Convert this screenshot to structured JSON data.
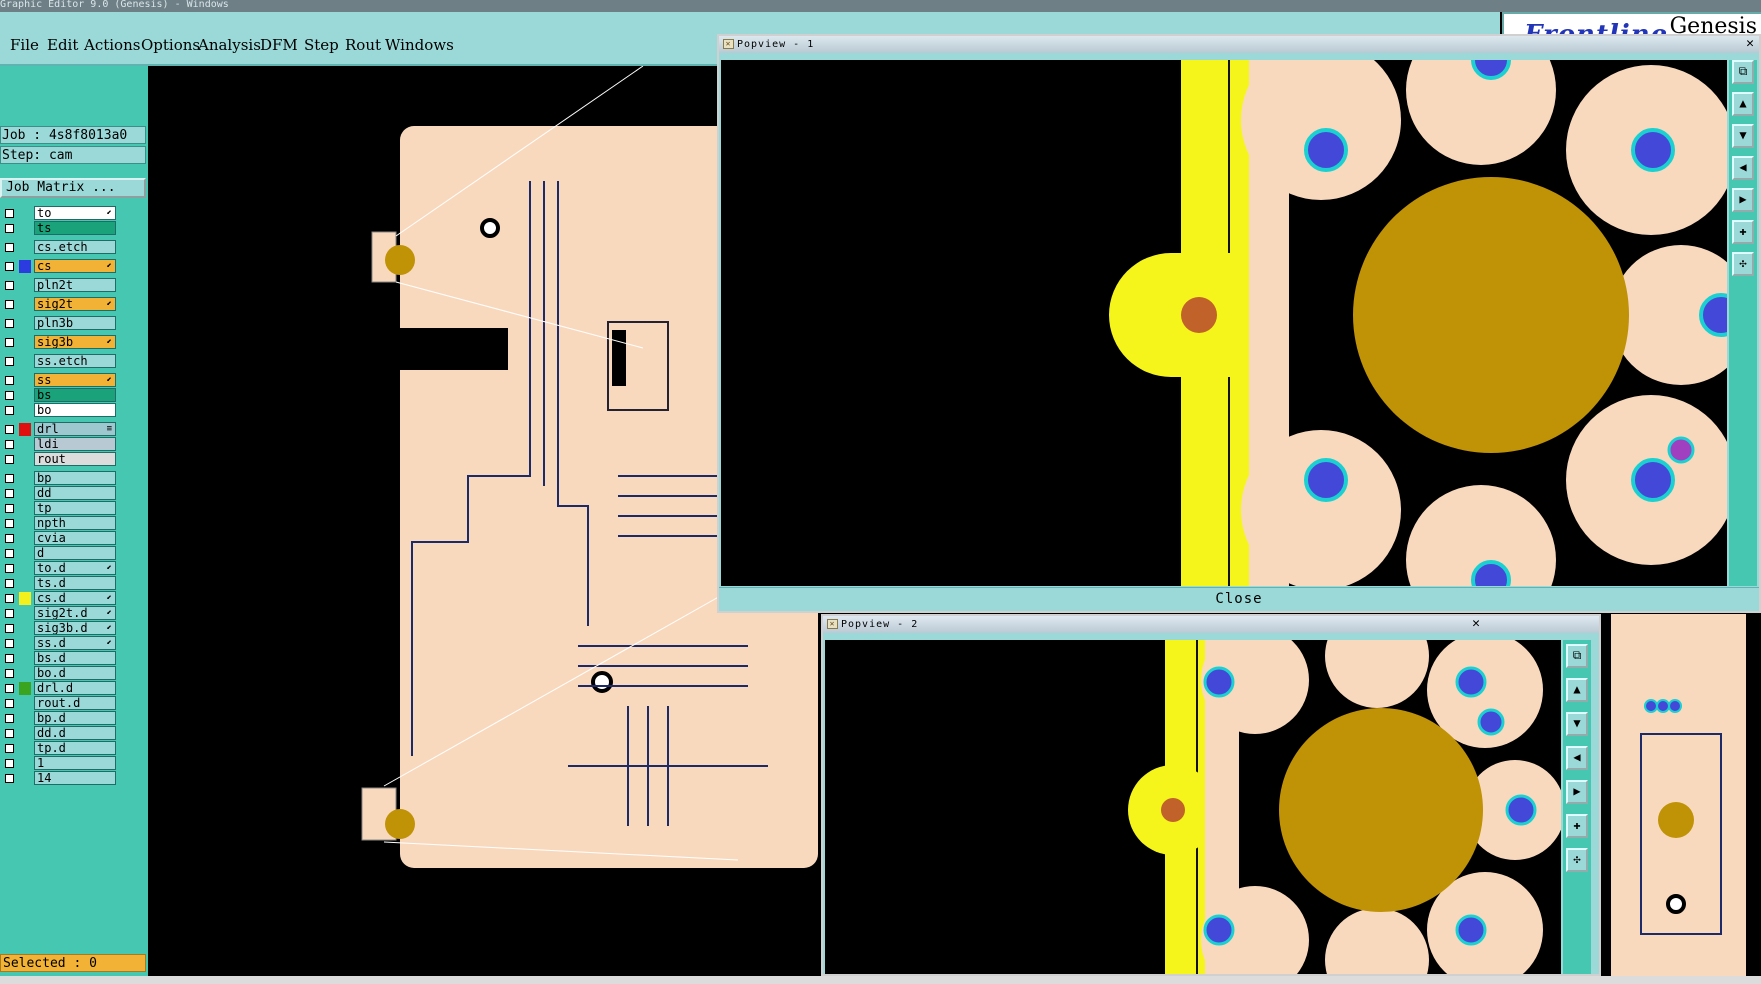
{
  "titlebar": {
    "text": "Graphic Editor 9.0 (Genesis) - Windows"
  },
  "menu": [
    "File",
    "Edit",
    "Actions",
    "Options",
    "Analysis",
    "DFM",
    "Step",
    "Rout",
    "Windows"
  ],
  "brand": {
    "logo": "Frontline",
    "product": "Genesis"
  },
  "job": {
    "label": "Job : 4s8f8013a0",
    "step": "Step: cam"
  },
  "job_matrix_button": "Job Matrix ...",
  "layers": [
    {
      "name": "to",
      "color": "#ffffff",
      "swatch": "",
      "mark": "⬋"
    },
    {
      "name": "ts",
      "color": "#1aa37a",
      "swatch": "",
      "mark": ""
    },
    {
      "name": "cs.etch",
      "color": "#9ad9d8",
      "swatch": "",
      "mark": ""
    },
    {
      "name": "cs",
      "color": "#f2b235",
      "swatch": "#2b3be0",
      "mark": "⬋"
    },
    {
      "name": "pln2t",
      "color": "#9ad9d8",
      "swatch": "",
      "mark": ""
    },
    {
      "name": "sig2t",
      "color": "#f2b235",
      "swatch": "",
      "mark": "⬋"
    },
    {
      "name": "pln3b",
      "color": "#9ad9d8",
      "swatch": "",
      "mark": ""
    },
    {
      "name": "sig3b",
      "color": "#f2b235",
      "swatch": "",
      "mark": "⬋"
    },
    {
      "name": "ss.etch",
      "color": "#9ad9d8",
      "swatch": "",
      "mark": ""
    },
    {
      "name": "ss",
      "color": "#f2b235",
      "swatch": "",
      "mark": "⬋"
    },
    {
      "name": "bs",
      "color": "#1aa37a",
      "swatch": "",
      "mark": ""
    },
    {
      "name": "bo",
      "color": "#ffffff",
      "swatch": "",
      "mark": ""
    },
    {
      "name": "drl",
      "color": "#9ec8d0",
      "swatch": "#e01010",
      "mark": "≡"
    },
    {
      "name": "ldi",
      "color": "#b9c9d3",
      "swatch": "",
      "mark": ""
    },
    {
      "name": "rout",
      "color": "#dcdcdc",
      "swatch": "",
      "mark": ""
    },
    {
      "name": "bp",
      "color": "#9ad9d8",
      "swatch": "",
      "mark": ""
    },
    {
      "name": "dd",
      "color": "#9ad9d8",
      "swatch": "",
      "mark": ""
    },
    {
      "name": "tp",
      "color": "#9ad9d8",
      "swatch": "",
      "mark": ""
    },
    {
      "name": "npth",
      "color": "#9ad9d8",
      "swatch": "",
      "mark": ""
    },
    {
      "name": "cvia",
      "color": "#9ad9d8",
      "swatch": "",
      "mark": ""
    },
    {
      "name": "d",
      "color": "#9ad9d8",
      "swatch": "",
      "mark": ""
    },
    {
      "name": "to.d",
      "color": "#9ad9d8",
      "swatch": "",
      "mark": "⬋"
    },
    {
      "name": "ts.d",
      "color": "#9ad9d8",
      "swatch": "",
      "mark": ""
    },
    {
      "name": "cs.d",
      "color": "#9ad9d8",
      "swatch": "#f4f01e",
      "mark": "⬋"
    },
    {
      "name": "sig2t.d",
      "color": "#9ad9d8",
      "swatch": "",
      "mark": "⬋"
    },
    {
      "name": "sig3b.d",
      "color": "#9ad9d8",
      "swatch": "",
      "mark": "⬋"
    },
    {
      "name": "ss.d",
      "color": "#9ad9d8",
      "swatch": "",
      "mark": "⬋"
    },
    {
      "name": "bs.d",
      "color": "#9ad9d8",
      "swatch": "",
      "mark": ""
    },
    {
      "name": "bo.d",
      "color": "#9ad9d8",
      "swatch": "",
      "mark": ""
    },
    {
      "name": "drl.d",
      "color": "#9ad9d8",
      "swatch": "#3aa420",
      "mark": ""
    },
    {
      "name": "rout.d",
      "color": "#9ad9d8",
      "swatch": "",
      "mark": ""
    },
    {
      "name": "bp.d",
      "color": "#9ad9d8",
      "swatch": "",
      "mark": ""
    },
    {
      "name": "dd.d",
      "color": "#9ad9d8",
      "swatch": "",
      "mark": ""
    },
    {
      "name": "tp.d",
      "color": "#9ad9d8",
      "swatch": "",
      "mark": ""
    },
    {
      "name": "1",
      "color": "#9ad9d8",
      "swatch": "",
      "mark": ""
    },
    {
      "name": "14",
      "color": "#9ad9d8",
      "swatch": "",
      "mark": ""
    }
  ],
  "selected": "Selected : 0",
  "popview1": {
    "title": "Popview - 1",
    "close_label": "Close"
  },
  "popview2": {
    "title": "Popview - 2"
  },
  "colors": {
    "pad": "#f9d9bd",
    "copper_fill": "#c09205",
    "via": "#4448d8",
    "via_ring": "#1ad0d0",
    "yellow": "#f5f51c",
    "drill": "#c0622a"
  }
}
